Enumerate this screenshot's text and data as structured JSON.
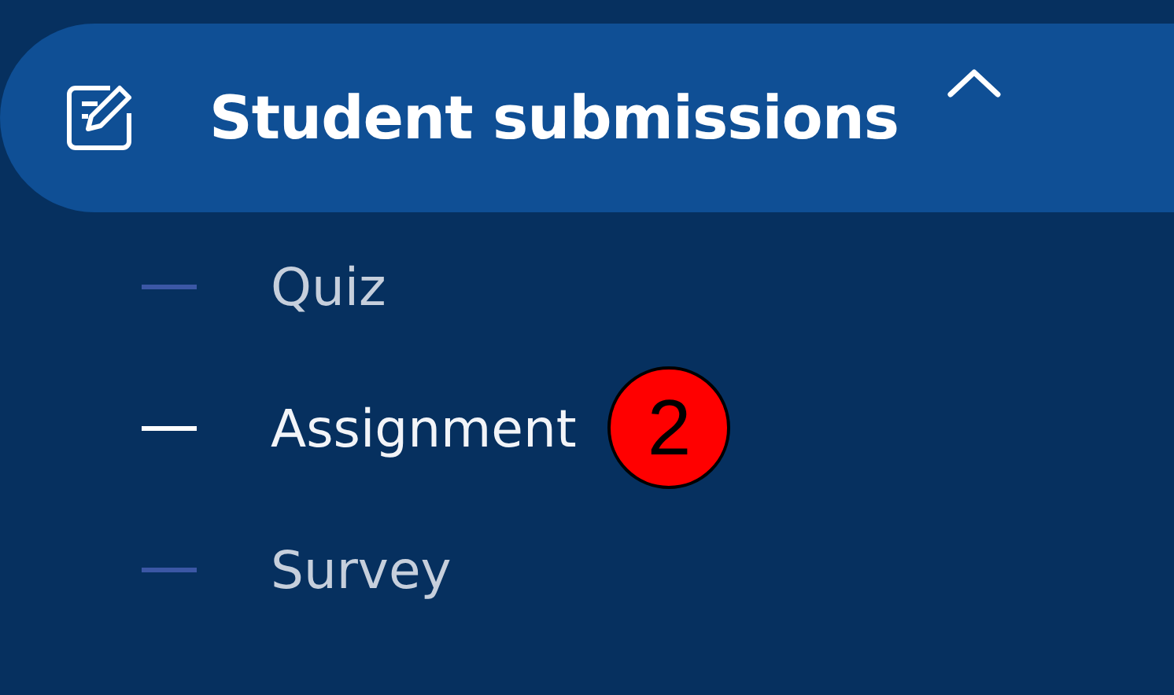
{
  "menu_group": {
    "label": "Student submissions",
    "expanded": true
  },
  "items": [
    {
      "label": "Quiz",
      "selected": false
    },
    {
      "label": "Assignment",
      "selected": true,
      "badge": "2"
    },
    {
      "label": "Survey",
      "selected": false
    }
  ]
}
